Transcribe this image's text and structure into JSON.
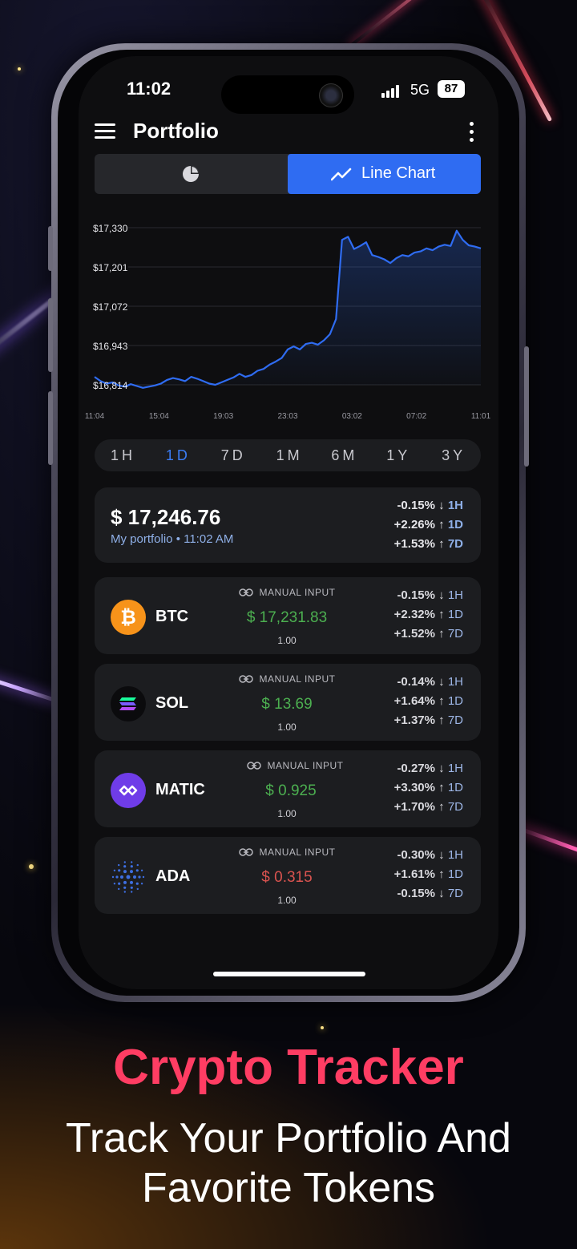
{
  "status_bar": {
    "time": "11:02",
    "network": "5G",
    "battery": "87"
  },
  "app_bar": {
    "title": "Portfolio"
  },
  "view_toggle": {
    "pie_icon": "pie-chart-icon",
    "line_label": "Line Chart",
    "line_icon": "trend-line-icon",
    "accent": "#2f6cf2"
  },
  "chart_data": {
    "type": "line",
    "x": [
      "11:04",
      "15:04",
      "19:03",
      "23:03",
      "03:02",
      "07:02",
      "11:01"
    ],
    "y_ticks": [
      "$17,330",
      "$17,201",
      "$17,072",
      "$16,943",
      "$16,814"
    ],
    "ylim": [
      16814,
      17330
    ],
    "series": [
      {
        "color": "#2f6cf2",
        "values": [
          16840,
          16826,
          16818,
          16822,
          16812,
          16808,
          16816,
          16810,
          16804,
          16808,
          16812,
          16818,
          16830,
          16836,
          16832,
          16826,
          16840,
          16834,
          16826,
          16818,
          16814,
          16822,
          16830,
          16838,
          16850,
          16840,
          16846,
          16860,
          16866,
          16880,
          16890,
          16902,
          16930,
          16940,
          16930,
          16948,
          16952,
          16946,
          16960,
          16980,
          17030,
          17290,
          17300,
          17260,
          17270,
          17282,
          17240,
          17234,
          17226,
          17214,
          17230,
          17240,
          17236,
          17248,
          17252,
          17262,
          17256,
          17268,
          17274,
          17270,
          17320,
          17290,
          17272,
          17268,
          17262
        ]
      }
    ]
  },
  "time_ranges": {
    "items": [
      "1H",
      "1D",
      "7D",
      "1M",
      "6M",
      "1Y",
      "3Y"
    ],
    "active": "1D"
  },
  "portfolio": {
    "total": "$ 17,246.76",
    "subtitle": "My portfolio • 11:02 AM",
    "changes": [
      {
        "value": "-0.15%",
        "arrow": "↓",
        "period": "1H"
      },
      {
        "value": "+2.26%",
        "arrow": "↑",
        "period": "1D"
      },
      {
        "value": "+1.53%",
        "arrow": "↑",
        "period": "7D"
      }
    ]
  },
  "assets": [
    {
      "symbol": "BTC",
      "icon": "bitcoin-icon",
      "source": "MANUAL INPUT",
      "price": "$ 17,231.83",
      "price_color": "#4caf50",
      "quantity": "1.00",
      "changes": [
        {
          "value": "-0.15%",
          "arrow": "↓",
          "period": "1H"
        },
        {
          "value": "+2.32%",
          "arrow": "↑",
          "period": "1D"
        },
        {
          "value": "+1.52%",
          "arrow": "↑",
          "period": "7D"
        }
      ]
    },
    {
      "symbol": "SOL",
      "icon": "solana-icon",
      "source": "MANUAL INPUT",
      "price": "$ 13.69",
      "price_color": "#4caf50",
      "quantity": "1.00",
      "changes": [
        {
          "value": "-0.14%",
          "arrow": "↓",
          "period": "1H"
        },
        {
          "value": "+1.64%",
          "arrow": "↑",
          "period": "1D"
        },
        {
          "value": "+1.37%",
          "arrow": "↑",
          "period": "7D"
        }
      ]
    },
    {
      "symbol": "MATIC",
      "icon": "polygon-icon",
      "source": "MANUAL INPUT",
      "price": "$ 0.925",
      "price_color": "#4caf50",
      "quantity": "1.00",
      "changes": [
        {
          "value": "-0.27%",
          "arrow": "↓",
          "period": "1H"
        },
        {
          "value": "+3.30%",
          "arrow": "↑",
          "period": "1D"
        },
        {
          "value": "+1.70%",
          "arrow": "↑",
          "period": "7D"
        }
      ]
    },
    {
      "symbol": "ADA",
      "icon": "cardano-icon",
      "source": "MANUAL INPUT",
      "price": "$ 0.315",
      "price_color": "#d9534f",
      "quantity": "1.00",
      "changes": [
        {
          "value": "-0.30%",
          "arrow": "↓",
          "period": "1H"
        },
        {
          "value": "+1.61%",
          "arrow": "↑",
          "period": "1D"
        },
        {
          "value": "-0.15%",
          "arrow": "↓",
          "period": "7D"
        }
      ]
    }
  ],
  "promo": {
    "headline": "Crypto Tracker",
    "line1": "Track Your Portfolio And",
    "line2": "Favorite Tokens",
    "headline_color": "#ff3d63"
  }
}
